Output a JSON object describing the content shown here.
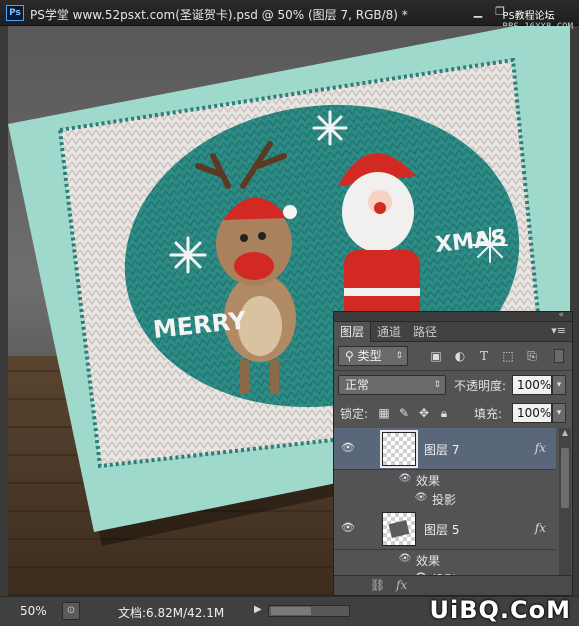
{
  "app": {
    "logo": "Ps",
    "title": "PS学堂 www.52psxt.com(圣诞贺卡).psd @ 50% (图层 7, RGB/8) *"
  },
  "window": {
    "minimize": "▁",
    "restore": "❐",
    "close": "✕"
  },
  "watermark_top": {
    "line1": "PS教程论坛",
    "line2": "BBS.16XX8.COM"
  },
  "canvas": {
    "card_text_left": "MERRY",
    "card_text_right": "XMAS",
    "colors": {
      "card_mint": "#9fd9cc",
      "knit_white": "#ece8e6",
      "knit_teal": "#2b8a84",
      "santa_red": "#d22a22",
      "deer_brown": "#a27a55"
    }
  },
  "layers_panel": {
    "tabs": [
      {
        "label": "图层",
        "active": true
      },
      {
        "label": "通道",
        "active": false
      },
      {
        "label": "路径",
        "active": false
      }
    ],
    "panel_menu_icon": "menu-icon",
    "filter_kind": "类型",
    "blend_mode": "正常",
    "opacity_label": "不透明度:",
    "opacity_value": "100%",
    "lock_label": "锁定:",
    "fill_label": "填充:",
    "fill_value": "100%",
    "layers": [
      {
        "name": "图层 7",
        "selected": true,
        "fx": "fx",
        "effects_label": "效果",
        "effect": "投影"
      },
      {
        "name": "图层 5",
        "selected": false,
        "fx": "fx",
        "effects_label": "效果",
        "effect": "投影"
      }
    ],
    "footer_icons": [
      "link-icon",
      "fx-icon"
    ]
  },
  "status_bar": {
    "zoom": "50%",
    "doc_info": "文档:6.82M/42.1M"
  },
  "watermark_bottom": "UiBQ.CoM"
}
